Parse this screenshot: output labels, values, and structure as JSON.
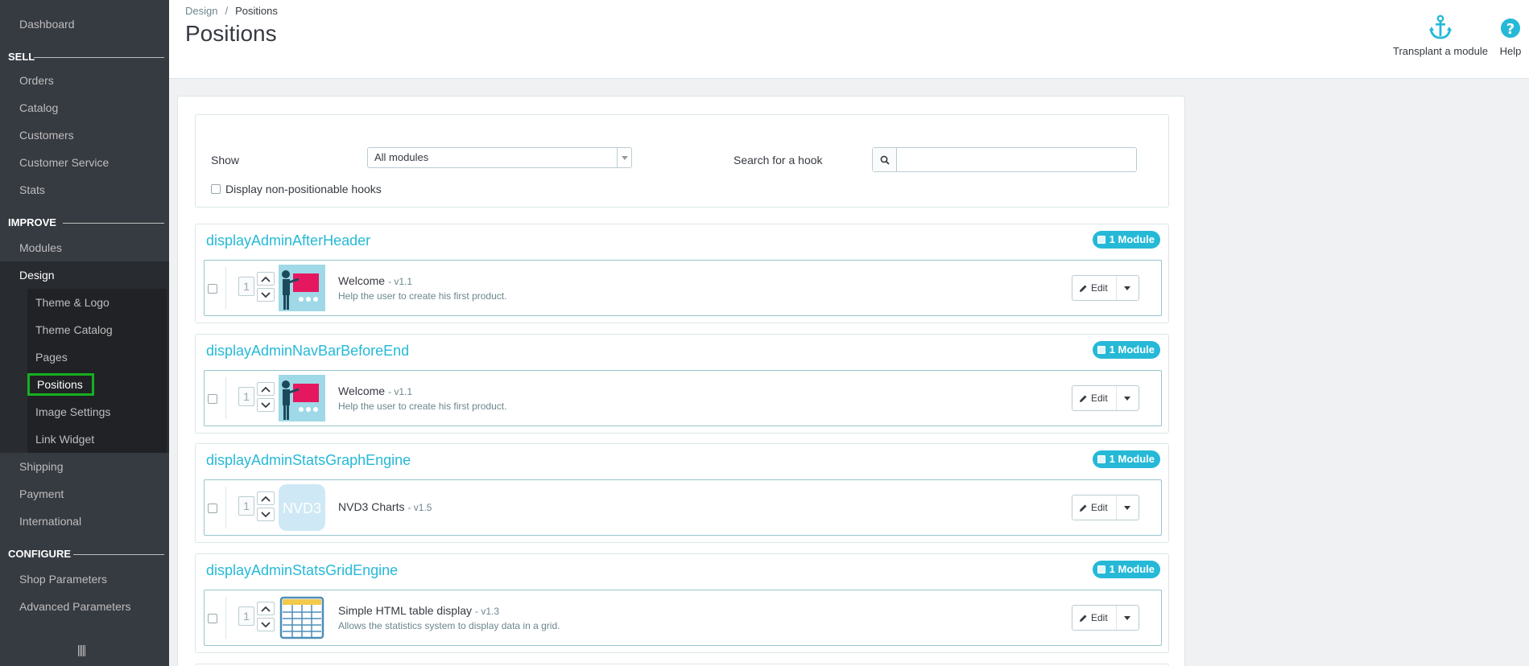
{
  "sidebar": {
    "dashboard": "Dashboard",
    "sections": {
      "sell": "SELL",
      "improve": "IMPROVE",
      "configure": "CONFIGURE"
    },
    "sell_items": [
      "Orders",
      "Catalog",
      "Customers",
      "Customer Service",
      "Stats"
    ],
    "improve_items": [
      "Modules",
      "Design"
    ],
    "design_subitems": [
      "Theme & Logo",
      "Theme Catalog",
      "Pages",
      "Positions",
      "Image Settings",
      "Link Widget"
    ],
    "improve_items_after": [
      "Shipping",
      "Payment",
      "International"
    ],
    "configure_items": [
      "Shop Parameters",
      "Advanced Parameters"
    ]
  },
  "header": {
    "breadcrumb": [
      "Design",
      "Positions"
    ],
    "breadcrumb_sep": "/",
    "title": "Positions",
    "transplant_label": "Transplant a module",
    "help_label": "Help"
  },
  "filters": {
    "show_label": "Show",
    "show_value": "All modules",
    "search_label": "Search for a hook",
    "search_value": "",
    "nonpositionable_label": "Display non-positionable hooks"
  },
  "hooks": [
    {
      "name": "displayAdminAfterHeader",
      "badge": "1 Module",
      "module": {
        "position": "1",
        "name": "Welcome",
        "version": "- v1.1",
        "description": "Help the user to create his first product.",
        "icon": "welcome-icon"
      }
    },
    {
      "name": "displayAdminNavBarBeforeEnd",
      "badge": "1 Module",
      "module": {
        "position": "1",
        "name": "Welcome",
        "version": "- v1.1",
        "description": "Help the user to create his first product.",
        "icon": "welcome-icon"
      }
    },
    {
      "name": "displayAdminStatsGraphEngine",
      "badge": "1 Module",
      "module": {
        "position": "1",
        "name": "NVD3 Charts",
        "version": "- v1.5",
        "description": "",
        "icon": "nvd3-icon",
        "icon_text": "NVD3"
      }
    },
    {
      "name": "displayAdminStatsGridEngine",
      "badge": "1 Module",
      "module": {
        "position": "1",
        "name": "Simple HTML table display",
        "version": "- v1.3",
        "description": "Allows the statistics system to display data in a grid.",
        "icon": "grid-table-icon"
      }
    }
  ],
  "edit_label": "Edit",
  "colors": {
    "sidebar_bg": "#363a41",
    "accent": "#25b9d7",
    "highlight": "#16b01f"
  }
}
